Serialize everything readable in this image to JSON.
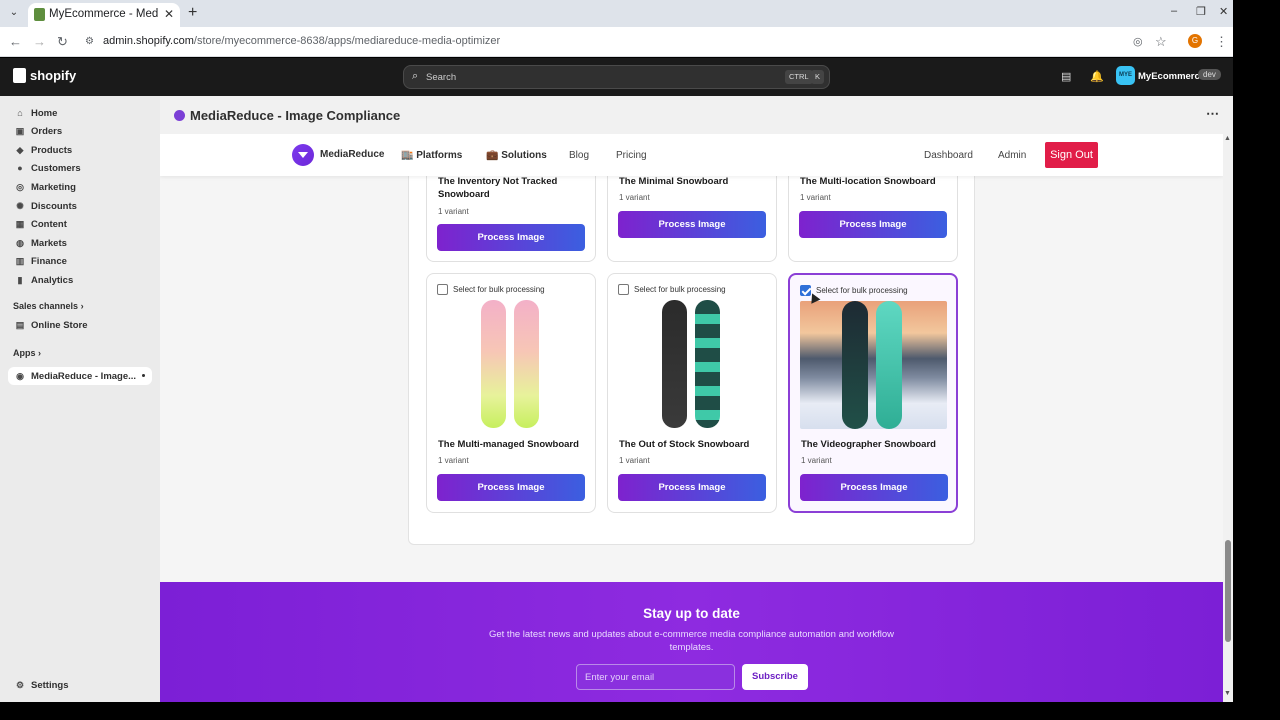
{
  "browser": {
    "tab_title": "MyEcommerce - MediaR",
    "url_domain": "admin.shopify.com",
    "url_path": "/store/myecommerce-8638/apps/mediareduce-media-optimizer",
    "profile_initial": "G"
  },
  "shopify": {
    "logo_text": "shopify",
    "search_placeholder": "Search",
    "kbd1": "CTRL",
    "kbd2": "K",
    "store_initials": "MYE",
    "store_name": "MyEcommerce",
    "store_badge": "dev"
  },
  "sidebar": {
    "items": [
      {
        "label": "Home",
        "icon": "home-icon"
      },
      {
        "label": "Orders",
        "icon": "orders-icon"
      },
      {
        "label": "Products",
        "icon": "tag-icon"
      },
      {
        "label": "Customers",
        "icon": "person-icon"
      },
      {
        "label": "Marketing",
        "icon": "target-icon"
      },
      {
        "label": "Discounts",
        "icon": "discount-icon"
      },
      {
        "label": "Content",
        "icon": "content-icon"
      },
      {
        "label": "Markets",
        "icon": "globe-icon"
      },
      {
        "label": "Finance",
        "icon": "bank-icon"
      },
      {
        "label": "Analytics",
        "icon": "chart-icon"
      }
    ],
    "sales_channels": "Sales channels",
    "online_store": "Online Store",
    "apps": "Apps",
    "app_item": "MediaReduce - Image...",
    "settings": "Settings"
  },
  "app": {
    "title": "MediaReduce - Image Compliance"
  },
  "inner_nav": {
    "brand": "MediaReduce",
    "platforms": "🏬 Platforms",
    "solutions": "💼 Solutions",
    "blog": "Blog",
    "pricing": "Pricing",
    "dashboard": "Dashboard",
    "admin": "Admin",
    "sign_out": "Sign Out"
  },
  "products": {
    "select_label": "Select for bulk processing",
    "variant": "1 variant",
    "process_label": "Process Image",
    "top_row": [
      {
        "name": "The Inventory Not Tracked Snowboard"
      },
      {
        "name": "The Minimal Snowboard"
      },
      {
        "name": "The Multi-location Snowboard"
      }
    ],
    "bottom_row": [
      {
        "name": "The Multi-managed Snowboard",
        "selected": false
      },
      {
        "name": "The Out of Stock Snowboard",
        "selected": false
      },
      {
        "name": "The Videographer Snowboard",
        "selected": true
      }
    ]
  },
  "newsletter": {
    "title": "Stay up to date",
    "text": "Get the latest news and updates about e-commerce media compliance automation and workflow templates.",
    "placeholder": "Enter your email",
    "button": "Subscribe"
  },
  "colors": {
    "accent": "#7e22ce",
    "signout": "#e11d48",
    "newsletter": "#8e2be0"
  }
}
